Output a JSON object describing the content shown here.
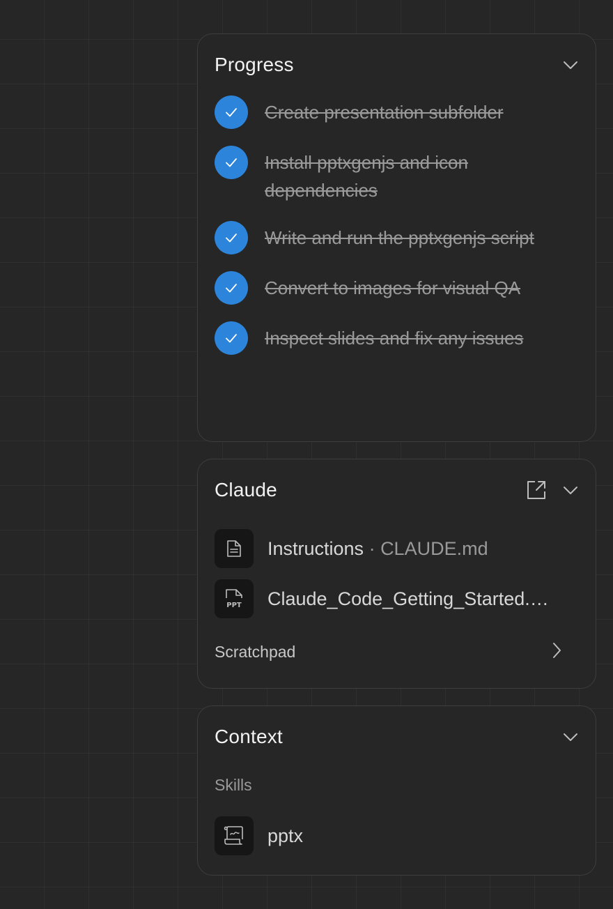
{
  "progress": {
    "title": "Progress",
    "tasks": [
      {
        "label": "Create presentation subfolder",
        "done": true
      },
      {
        "label": "Install pptxgenjs and icon dependencies",
        "done": true
      },
      {
        "label": "Write and run the pptxgenjs script",
        "done": true
      },
      {
        "label": "Convert to images for visual QA",
        "done": true
      },
      {
        "label": "Inspect slides and fix any issues",
        "done": true
      }
    ]
  },
  "claude": {
    "title": "Claude",
    "files": [
      {
        "name": "Instructions",
        "separator": " · ",
        "sub": "CLAUDE.md",
        "icon": "document-icon"
      },
      {
        "name": "Claude_Code_Getting_Started.…",
        "icon": "ppt-file-icon"
      }
    ],
    "scratchpad_label": "Scratchpad"
  },
  "context": {
    "title": "Context",
    "skills_label": "Skills",
    "skills": [
      {
        "name": "pptx",
        "icon": "scroll-icon"
      }
    ]
  },
  "colors": {
    "background": "#262626",
    "panel_border": "#3d3d3d",
    "check_accent": "#2c84db",
    "muted_text": "#9a9a9a"
  }
}
